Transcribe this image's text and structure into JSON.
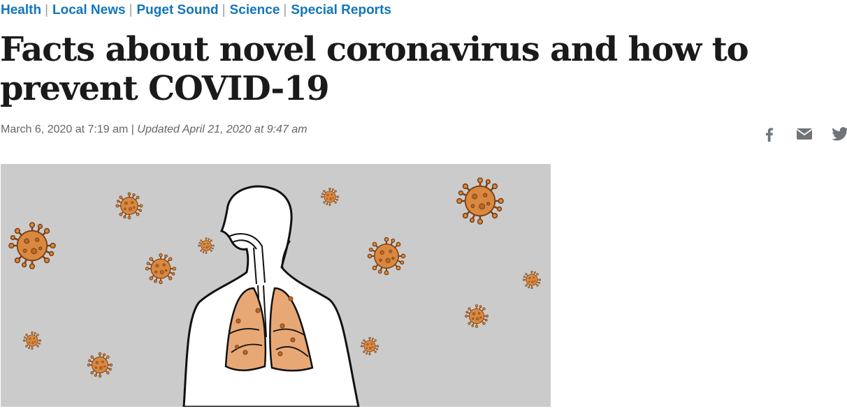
{
  "nav": {
    "items": [
      {
        "label": "Health"
      },
      {
        "label": "Local News"
      },
      {
        "label": "Puget Sound"
      },
      {
        "label": "Science"
      },
      {
        "label": "Special Reports"
      }
    ],
    "separator": "|"
  },
  "article": {
    "title": "Facts about novel coronavirus and how to prevent COVID-19",
    "published": "March 6, 2020 at 7:19 am",
    "meta_separator": "|",
    "updated": "Updated April 21, 2020 at 9:47 am"
  },
  "share": {
    "icons": [
      "facebook-icon",
      "email-icon",
      "twitter-icon"
    ]
  },
  "hero": {
    "description_icons": [
      "person-silhouette",
      "lungs",
      "coronavirus-particle"
    ]
  },
  "colors": {
    "nav_link": "#1276b9",
    "title": "#1a1a1a",
    "meta": "#666666",
    "hero_background": "#cbcbcb",
    "virus_orange": "#d9883f",
    "lung_fill": "#e8a875",
    "share_icon": "#6f7478"
  }
}
